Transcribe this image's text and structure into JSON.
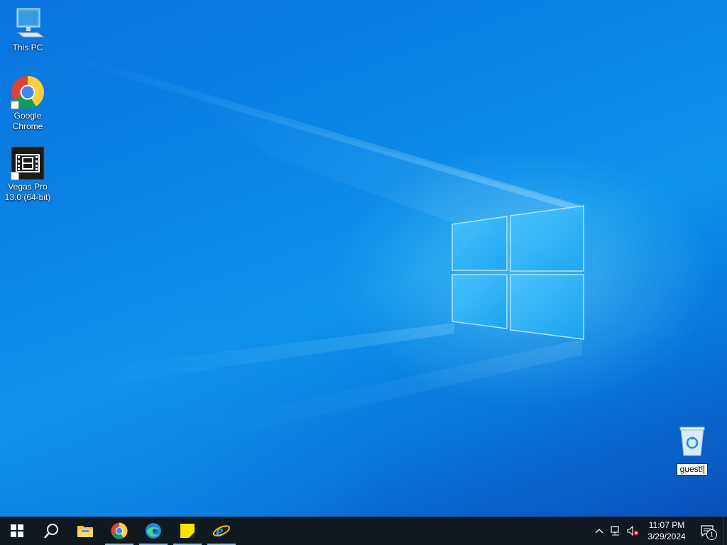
{
  "desktop": {
    "icons": [
      {
        "label": "This PC",
        "icon": "this-pc-icon"
      },
      {
        "label": "Google\nChrome",
        "icon": "chrome-icon"
      },
      {
        "label": "Vegas Pro\n13.0 (64-bit)",
        "icon": "vegas-pro-icon"
      }
    ],
    "recycle_bin": {
      "icon": "recycle-bin-icon",
      "rename_value": "guest!"
    }
  },
  "taskbar": {
    "items": [
      {
        "name": "start",
        "icon": "windows-start-icon"
      },
      {
        "name": "search",
        "icon": "search-icon"
      },
      {
        "name": "file-explorer",
        "icon": "folder-icon"
      },
      {
        "name": "chrome",
        "icon": "chrome-icon"
      },
      {
        "name": "edge",
        "icon": "edge-icon"
      },
      {
        "name": "sticky-notes",
        "icon": "sticky-notes-icon"
      },
      {
        "name": "internet-explorer",
        "icon": "internet-explorer-icon"
      }
    ],
    "tray": {
      "time": "11:07 PM",
      "date": "3/29/2024",
      "notification_count": "1"
    }
  },
  "colors": {
    "taskbar": "#101820",
    "desktop_blue": "#0b86e6"
  }
}
